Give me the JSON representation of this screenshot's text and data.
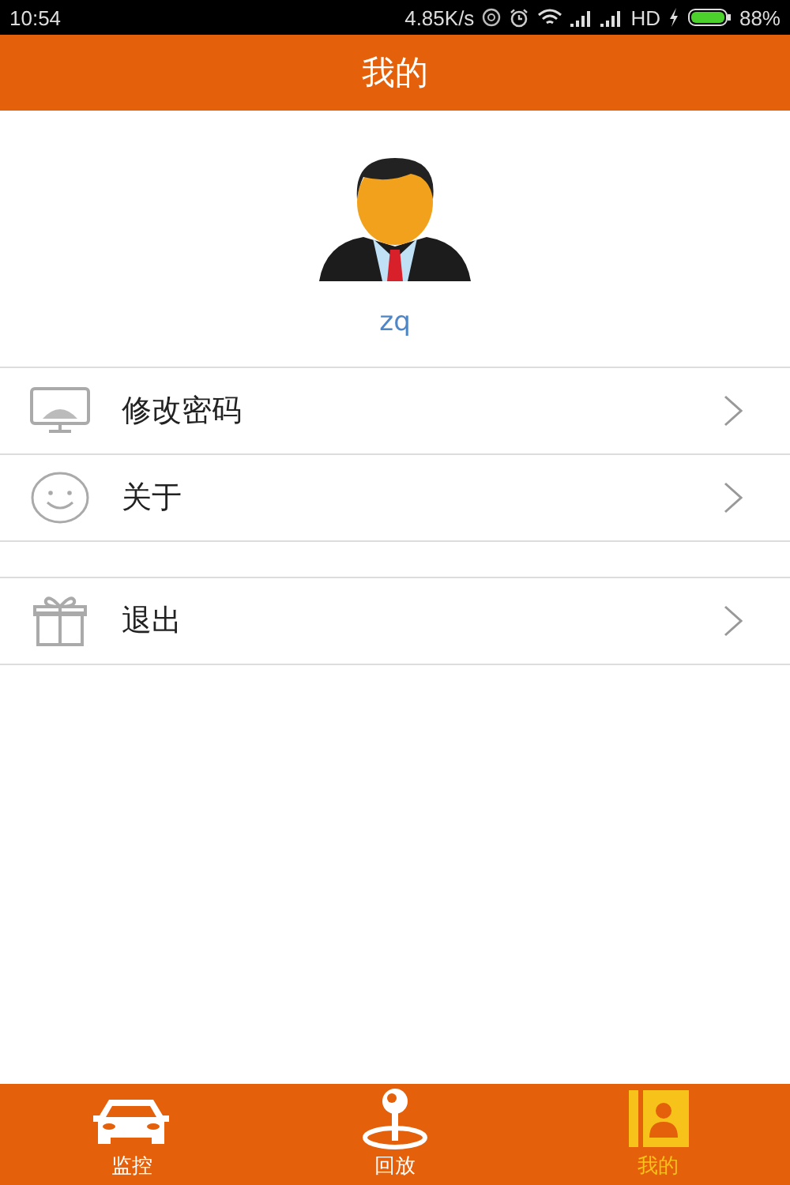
{
  "status_bar": {
    "time": "10:54",
    "speed": "4.85K/s",
    "network": "HD",
    "battery": "88%"
  },
  "header": {
    "title": "我的"
  },
  "profile": {
    "username": "zq"
  },
  "menu_groups": [
    {
      "items": [
        {
          "kind": "monitor",
          "label": "修改密码"
        },
        {
          "kind": "smile",
          "label": "关于"
        }
      ]
    },
    {
      "items": [
        {
          "kind": "gift",
          "label": "退出"
        }
      ]
    }
  ],
  "tabs": [
    {
      "kind": "car",
      "label": "监控",
      "selected": false
    },
    {
      "kind": "pin",
      "label": "回放",
      "selected": false
    },
    {
      "kind": "card",
      "label": "我的",
      "selected": true
    }
  ]
}
